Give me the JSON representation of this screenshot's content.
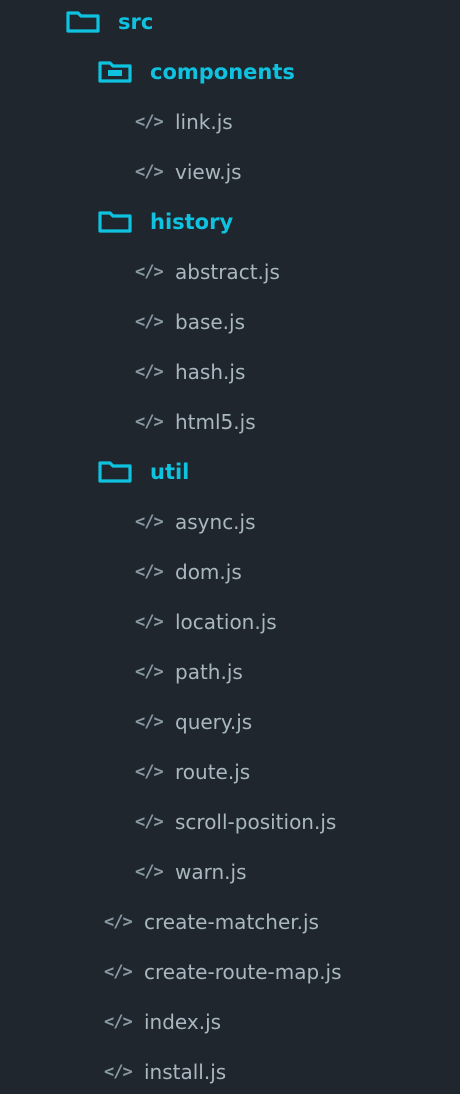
{
  "colors": {
    "background": "#1f262d",
    "folder_accent": "#0fc3e0",
    "file_text": "#a9b7c0",
    "file_icon": "#8a9aa5"
  },
  "tree": [
    {
      "type": "folder",
      "name": "src",
      "depth": 0,
      "icon": "folder-outline-icon"
    },
    {
      "type": "folder",
      "name": "components",
      "depth": 1,
      "icon": "folder-filled-icon"
    },
    {
      "type": "file",
      "name": "link.js",
      "depth": 2,
      "icon": "code-file-icon"
    },
    {
      "type": "file",
      "name": "view.js",
      "depth": 2,
      "icon": "code-file-icon"
    },
    {
      "type": "folder",
      "name": "history",
      "depth": 1,
      "icon": "folder-outline-icon"
    },
    {
      "type": "file",
      "name": "abstract.js",
      "depth": 2,
      "icon": "code-file-icon"
    },
    {
      "type": "file",
      "name": "base.js",
      "depth": 2,
      "icon": "code-file-icon"
    },
    {
      "type": "file",
      "name": "hash.js",
      "depth": 2,
      "icon": "code-file-icon"
    },
    {
      "type": "file",
      "name": "html5.js",
      "depth": 2,
      "icon": "code-file-icon"
    },
    {
      "type": "folder",
      "name": "util",
      "depth": 1,
      "icon": "folder-outline-icon"
    },
    {
      "type": "file",
      "name": "async.js",
      "depth": 2,
      "icon": "code-file-icon"
    },
    {
      "type": "file",
      "name": "dom.js",
      "depth": 2,
      "icon": "code-file-icon"
    },
    {
      "type": "file",
      "name": "location.js",
      "depth": 2,
      "icon": "code-file-icon"
    },
    {
      "type": "file",
      "name": "path.js",
      "depth": 2,
      "icon": "code-file-icon"
    },
    {
      "type": "file",
      "name": "query.js",
      "depth": 2,
      "icon": "code-file-icon"
    },
    {
      "type": "file",
      "name": "route.js",
      "depth": 2,
      "icon": "code-file-icon"
    },
    {
      "type": "file",
      "name": "scroll-position.js",
      "depth": 2,
      "icon": "code-file-icon"
    },
    {
      "type": "file",
      "name": "warn.js",
      "depth": 2,
      "icon": "code-file-icon"
    },
    {
      "type": "file",
      "name": "create-matcher.js",
      "depth": 1,
      "icon": "code-file-icon"
    },
    {
      "type": "file",
      "name": "create-route-map.js",
      "depth": 1,
      "icon": "code-file-icon"
    },
    {
      "type": "file",
      "name": "index.js",
      "depth": 1,
      "icon": "code-file-icon"
    },
    {
      "type": "file",
      "name": "install.js",
      "depth": 1,
      "icon": "code-file-icon"
    }
  ]
}
